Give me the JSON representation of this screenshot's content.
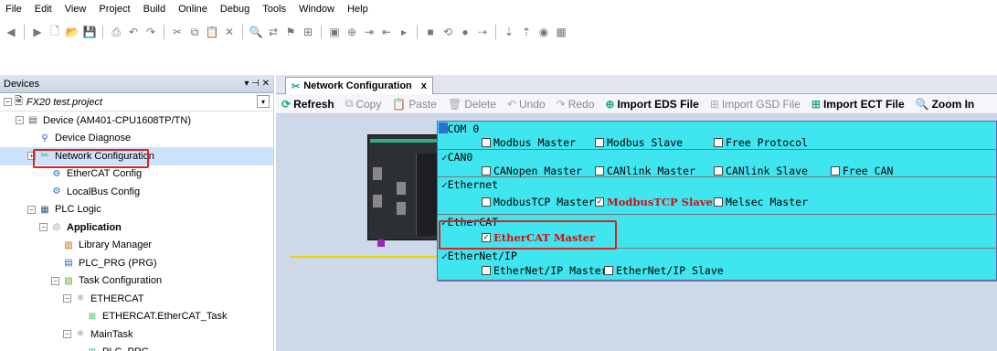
{
  "menu": [
    "File",
    "Edit",
    "View",
    "Project",
    "Build",
    "Online",
    "Debug",
    "Tools",
    "Window",
    "Help"
  ],
  "toolbar_icons": [
    "back-icon",
    "forward-icon",
    "new-icon",
    "open-icon",
    "save-icon",
    "print-icon",
    "undo-icon",
    "redo-icon",
    "cut-icon",
    "copy-icon",
    "paste-icon",
    "delete-icon",
    "find-icon",
    "replace-icon",
    "bookmark-icon",
    "insert-icon",
    "device-icon",
    "online-icon",
    "login-icon",
    "logout-icon",
    "run-icon",
    "stop-icon",
    "reset-icon",
    "breakpoint-icon",
    "step-icon",
    "step-into-icon",
    "step-out-icon",
    "watch-icon",
    "grid-icon"
  ],
  "devices": {
    "title": "Devices",
    "pin": "▾ ⊣ ✕",
    "project": "FX20 test.project",
    "tree": [
      {
        "label": "Device (AM401-CPU1608TP/TN)",
        "indent": 1,
        "exp": "−",
        "icon": "device-icon",
        "bold": false
      },
      {
        "label": "Device Diagnose",
        "indent": 2,
        "exp": "",
        "icon": "diagnose-icon",
        "bold": false
      },
      {
        "label": "Network Configuration",
        "indent": 2,
        "exp": "+",
        "icon": "network-icon",
        "bold": false,
        "selected": true
      },
      {
        "label": "EtherCAT Config",
        "indent": 3,
        "exp": "",
        "icon": "config-icon",
        "bold": false
      },
      {
        "label": "LocalBus Config",
        "indent": 3,
        "exp": "",
        "icon": "config-icon",
        "bold": false
      },
      {
        "label": "PLC Logic",
        "indent": 2,
        "exp": "−",
        "icon": "plc-icon",
        "bold": false
      },
      {
        "label": "Application",
        "indent": 3,
        "exp": "−",
        "icon": "application-icon",
        "bold": true
      },
      {
        "label": "Library Manager",
        "indent": 4,
        "exp": "",
        "icon": "library-icon",
        "bold": false
      },
      {
        "label": "PLC_PRG (PRG)",
        "indent": 4,
        "exp": "",
        "icon": "program-icon",
        "bold": false
      },
      {
        "label": "Task Configuration",
        "indent": 4,
        "exp": "−",
        "icon": "task-config-icon",
        "bold": false
      },
      {
        "label": "ETHERCAT",
        "indent": 5,
        "exp": "−",
        "icon": "task-icon",
        "bold": false
      },
      {
        "label": "ETHERCAT.EtherCAT_Task",
        "indent": 6,
        "exp": "",
        "icon": "task-call-icon",
        "bold": false
      },
      {
        "label": "MainTask",
        "indent": 5,
        "exp": "−",
        "icon": "task-icon",
        "bold": false
      },
      {
        "label": "PLC_PRG",
        "indent": 6,
        "exp": "",
        "icon": "task-call-icon",
        "bold": false
      }
    ]
  },
  "editor": {
    "tab_label": "Network Configuration",
    "tab_close": "x",
    "toolbar": [
      {
        "label": "Refresh",
        "enabled": true,
        "icon": "refresh-icon"
      },
      {
        "label": "Copy",
        "enabled": false,
        "icon": "copy-icon"
      },
      {
        "label": "Paste",
        "enabled": false,
        "icon": "paste-icon"
      },
      {
        "label": "Delete",
        "enabled": false,
        "icon": "delete-icon"
      },
      {
        "label": "Undo",
        "enabled": false,
        "icon": "undo-icon"
      },
      {
        "label": "Redo",
        "enabled": false,
        "icon": "redo-icon"
      },
      {
        "label": "Import EDS File",
        "enabled": true,
        "icon": "import-eds-icon"
      },
      {
        "label": "Import GSD File",
        "enabled": false,
        "icon": "import-gsd-icon"
      },
      {
        "label": "Import ECT File",
        "enabled": true,
        "icon": "import-ect-icon"
      },
      {
        "label": "Zoom In",
        "enabled": true,
        "icon": "zoom-in-icon"
      }
    ]
  },
  "config": {
    "sections": [
      {
        "title": "COM 0",
        "options": [
          {
            "label": "Modbus Master",
            "checked": false
          },
          {
            "label": "Modbus Slave",
            "checked": false
          },
          {
            "label": "Free Protocol",
            "checked": false
          }
        ]
      },
      {
        "title": "CAN0",
        "options": [
          {
            "label": "CANopen Master",
            "checked": false
          },
          {
            "label": "CANlink Master",
            "checked": false
          },
          {
            "label": "CANlink Slave",
            "checked": false
          },
          {
            "label": "Free CAN",
            "checked": false
          }
        ]
      },
      {
        "title": "Ethernet",
        "options": [
          {
            "label": "ModbusTCP Master",
            "checked": false
          },
          {
            "label": "ModbusTCP Slave",
            "checked": true
          },
          {
            "label": "Melsec Master",
            "checked": false
          }
        ]
      },
      {
        "title": "EtherCAT",
        "options": [
          {
            "label": "EtherCAT Master",
            "checked": true
          }
        ]
      },
      {
        "title": "EtherNet/IP",
        "options": [
          {
            "label": "EtherNet/IP Master",
            "checked": false
          },
          {
            "label": "EtherNet/IP Slave",
            "checked": false
          }
        ]
      }
    ]
  },
  "colors": {
    "config_bg": "#3fe5ef",
    "highlight": "#e02020",
    "bus": "#e8d400",
    "checked_text": "#d01010"
  }
}
